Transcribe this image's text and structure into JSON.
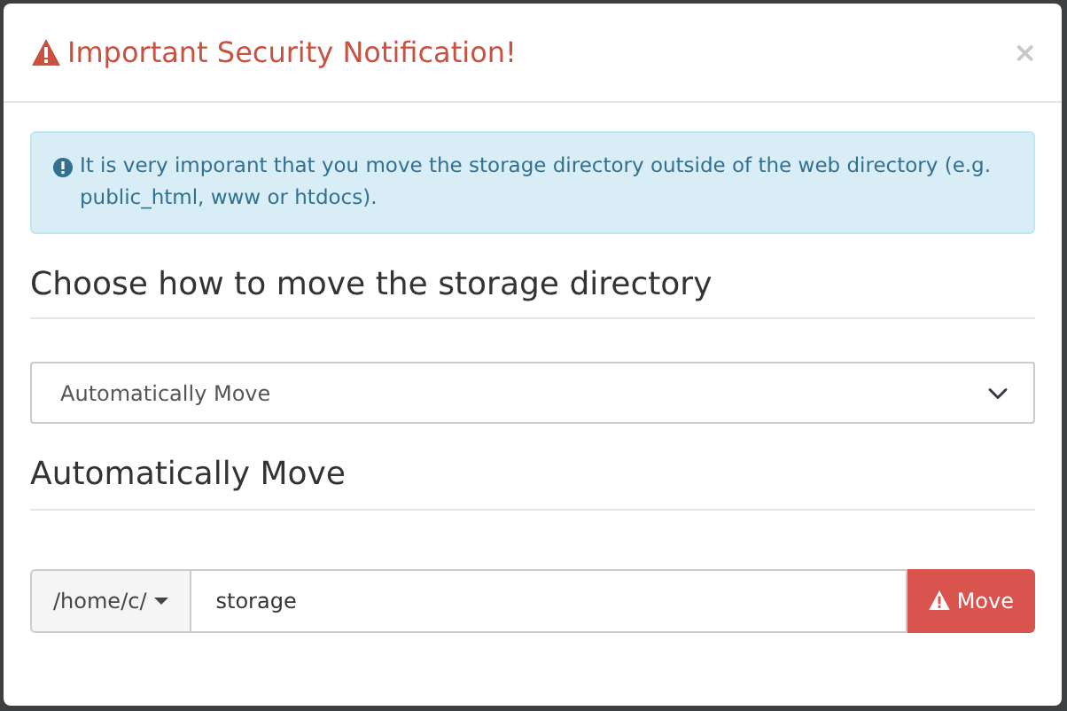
{
  "dialog": {
    "title": "Important Security Notification!",
    "close": "×"
  },
  "alert": {
    "text": "It is very imporant that you move the storage directory outside of the web directory (e.g. public_html, www or htdocs)."
  },
  "method": {
    "heading": "Choose how to move the storage directory",
    "value": "Automatically Move"
  },
  "move": {
    "heading": "Automatically Move",
    "prefix": "/home/c/",
    "value": "storage",
    "button": "Move"
  }
}
